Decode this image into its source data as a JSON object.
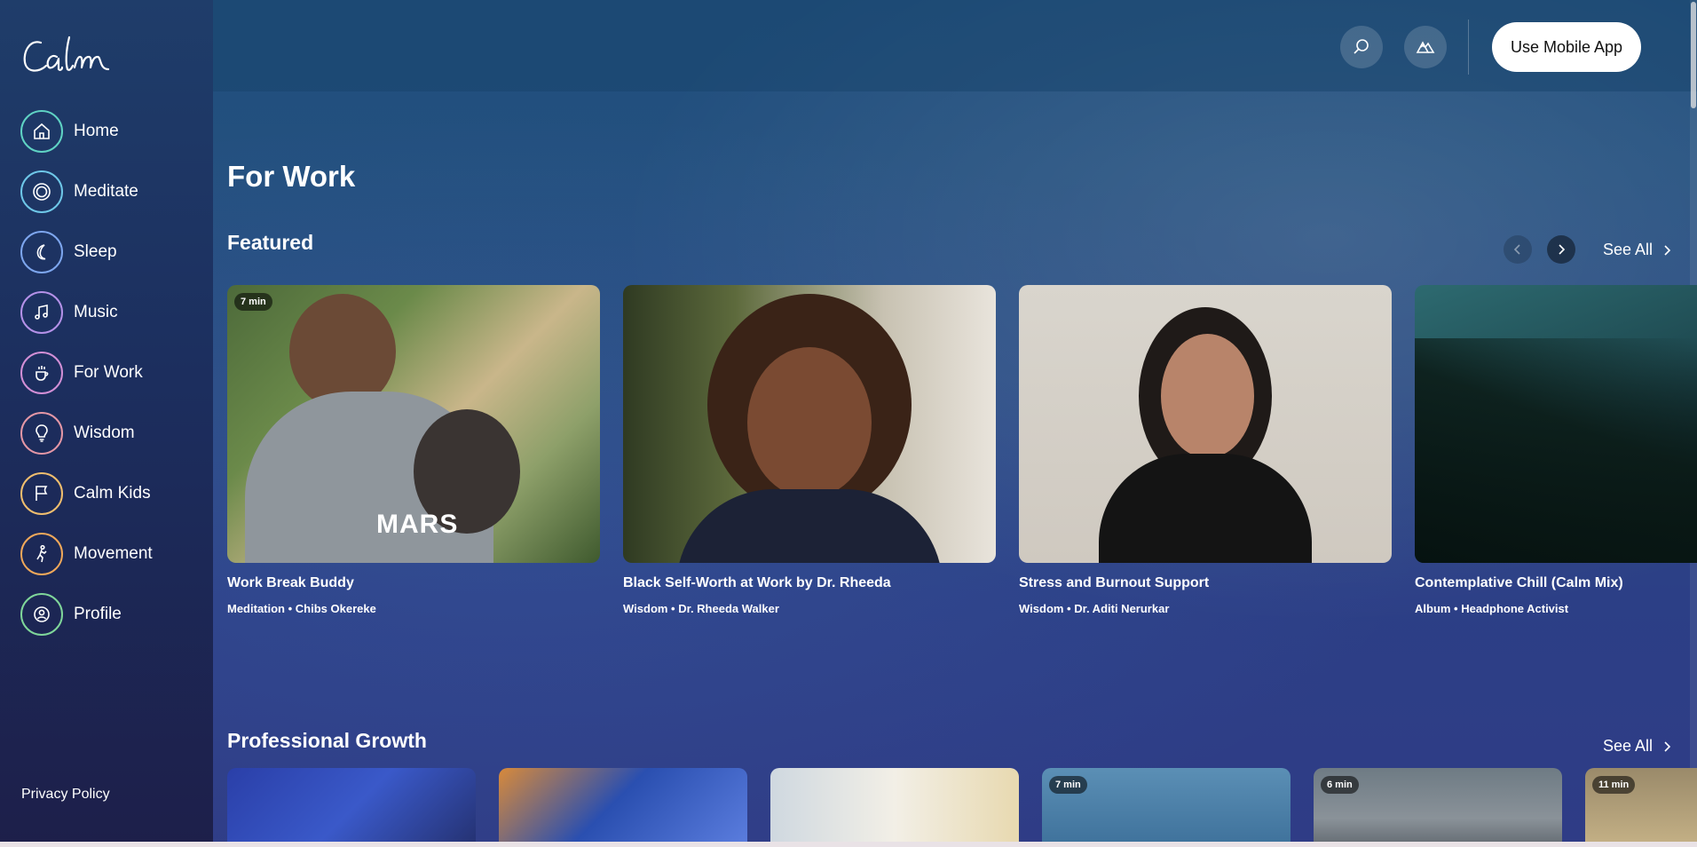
{
  "app": {
    "brand": "Calm"
  },
  "sidebar": {
    "items": [
      {
        "label": "Home",
        "icon": "home-icon",
        "color": "#5fd3c4"
      },
      {
        "label": "Meditate",
        "icon": "meditate-icon",
        "color": "#6ec7e8"
      },
      {
        "label": "Sleep",
        "icon": "moon-icon",
        "color": "#7da6ee"
      },
      {
        "label": "Music",
        "icon": "music-note-icon",
        "color": "#b491e8"
      },
      {
        "label": "For Work",
        "icon": "coffee-cup-icon",
        "color": "#d28fd6"
      },
      {
        "label": "Wisdom",
        "icon": "lightbulb-icon",
        "color": "#e497a6"
      },
      {
        "label": "Calm Kids",
        "icon": "flag-icon",
        "color": "#f0be6e"
      },
      {
        "label": "Movement",
        "icon": "movement-icon",
        "color": "#f0a85a"
      },
      {
        "label": "Profile",
        "icon": "user-icon",
        "color": "#7fd69a"
      }
    ],
    "privacy_policy": "Privacy Policy"
  },
  "header": {
    "search_icon": "search-icon",
    "scenes_icon": "mountains-icon",
    "mobile_button": "Use Mobile App"
  },
  "main": {
    "page_title": "For Work",
    "featured": {
      "title": "Featured",
      "see_all": "See All",
      "cards": [
        {
          "title": "Work Break Buddy",
          "subtitle": "Meditation • Chibs Okereke",
          "badge": "7 min",
          "image_text": "MARS"
        },
        {
          "title": "Black Self-Worth at Work by Dr. Rheeda",
          "subtitle": "Wisdom • Dr. Rheeda Walker"
        },
        {
          "title": "Stress and Burnout Support",
          "subtitle": "Wisdom • Dr. Aditi Nerurkar"
        },
        {
          "title": "Contemplative Chill (Calm Mix)",
          "subtitle": "Album • Headphone Activist"
        }
      ]
    },
    "professional_growth": {
      "title": "Professional Growth",
      "see_all": "See All",
      "cards": [
        {
          "badge": ""
        },
        {
          "badge": ""
        },
        {
          "badge": ""
        },
        {
          "badge": "7 min"
        },
        {
          "badge": "6 min"
        },
        {
          "badge": "11 min"
        }
      ]
    }
  }
}
